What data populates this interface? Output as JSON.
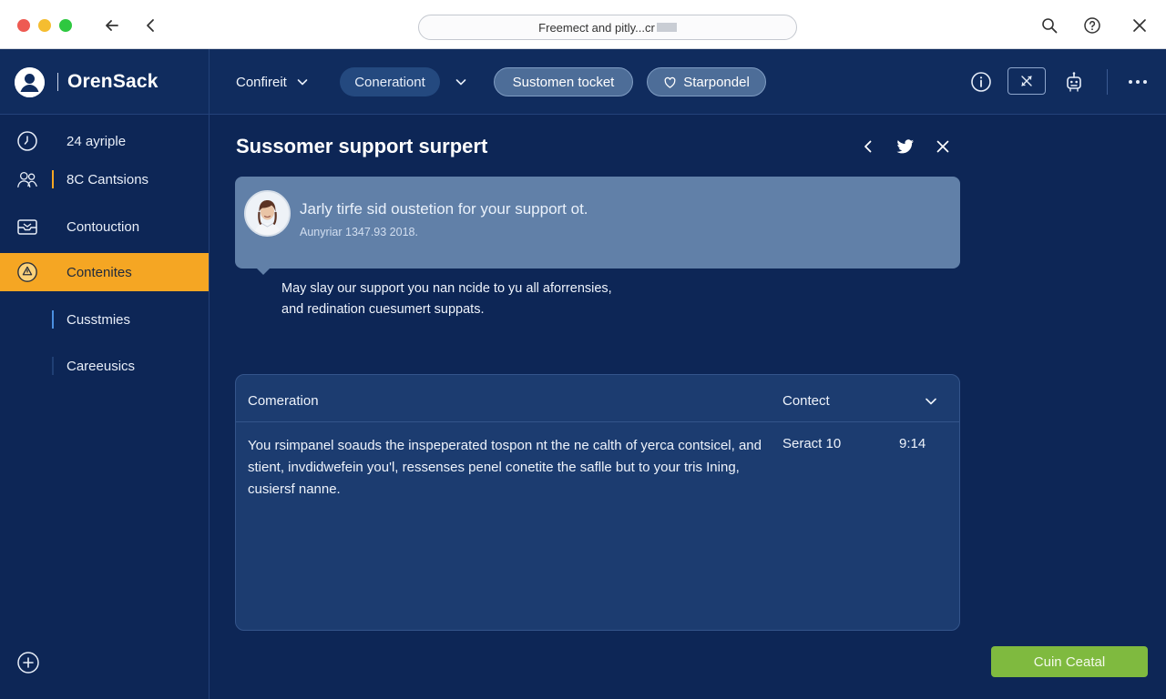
{
  "browser": {
    "url": "Freemect and pitly...cr",
    "back_icon": "arrow-left-icon",
    "prev_icon": "chevron-left-icon",
    "search_icon": "search-icon",
    "help_icon": "help-icon",
    "close_icon": "close-icon"
  },
  "app": {
    "name": "OrenSack",
    "nav": {
      "item1": "Confireit",
      "item2": "Conerationt",
      "item3": "Sustomen tocket",
      "item4": "Starpondel"
    }
  },
  "sidebar": {
    "items": [
      {
        "label": "24 ayriple",
        "icon": "clock-icon"
      },
      {
        "label": "8C Cantsions",
        "icon": "users-icon"
      },
      {
        "label": "Contouction",
        "icon": "inbox-icon"
      },
      {
        "label": "Contenites",
        "icon": "alert-icon",
        "active": true
      },
      {
        "label": "Cusstmies",
        "icon": ""
      },
      {
        "label": "Careeusics",
        "icon": ""
      }
    ],
    "add_icon": "plus-circle-icon"
  },
  "main": {
    "title": "Sussomer support surpert",
    "message": {
      "text": "Jarly tirfe sid oustetion for your support ot.",
      "meta": "Aunyriar 1347.93 2018."
    },
    "reply": {
      "line1": "May slay our support you nan ncide to yu all aforrensies,",
      "line2": "and redination cuesumert suppats."
    },
    "table": {
      "col1": "Comeration",
      "col2": "Contect",
      "row": {
        "text": "You rsimpanel soauds the inspeperated tospon nt the ne calth of yerca contsicel, and stient, invdidwefein you'l, ressenses penel conetite the saflle but to your tris Ining, cusiersf nanne.",
        "contact": "Seract 10",
        "time": "9:14"
      }
    },
    "cta_label": "Cuin Ceatal"
  },
  "colors": {
    "background": "#0d2656",
    "accent": "#f5a623",
    "cta": "#7fba3f",
    "card": "#6180a8"
  }
}
